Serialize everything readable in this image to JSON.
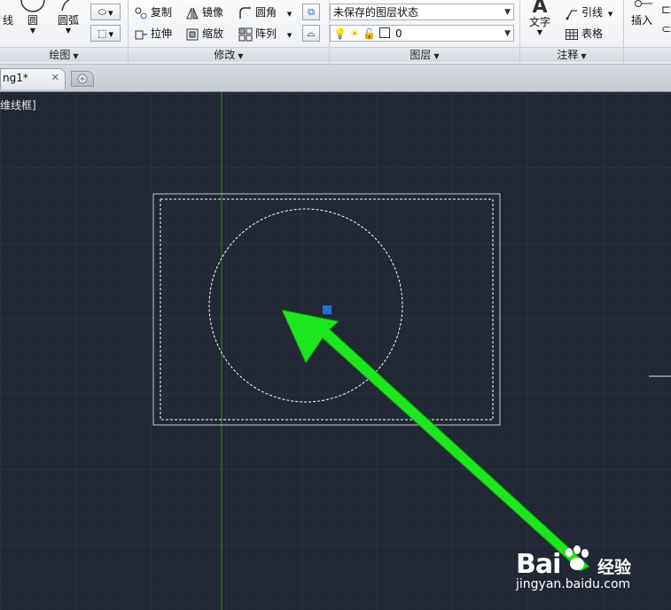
{
  "ribbon": {
    "draw_panel": {
      "title": "绘图",
      "tools": {
        "line": "线",
        "circle": "圆",
        "arc": "圆弧"
      }
    },
    "modify_panel": {
      "title": "修改",
      "tools": {
        "copy": "复制",
        "mirror": "镜像",
        "fillet": "圆角",
        "stretch": "拉伸",
        "scale": "缩放",
        "array": "阵列"
      }
    },
    "layers_panel": {
      "title": "图层",
      "layer_state": "未保存的图层状态",
      "current_layer": "0"
    },
    "annotation_panel": {
      "title": "注释",
      "tools": {
        "text": "文字",
        "leader": "引线",
        "table": "表格"
      }
    },
    "block_panel": {
      "tools": {
        "insert": "插入"
      }
    }
  },
  "tabs": {
    "active_doc": "ng1*"
  },
  "viewport": {
    "view_label": "维线框]"
  },
  "watermark": {
    "brand": "Bai",
    "brand_suffix": "经验",
    "url": "jingyan.baidu.com"
  },
  "colors": {
    "canvas": "#212733",
    "grid": "#2e3644",
    "arrow": "#1ee61e",
    "grip": "#1f6fe0",
    "selection": "#ffffff"
  }
}
